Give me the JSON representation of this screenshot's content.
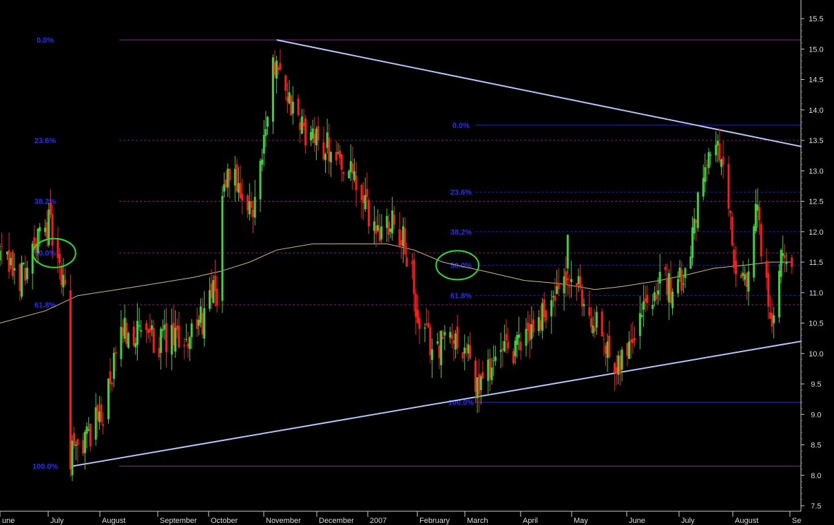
{
  "chart_data": {
    "type": "candlestick",
    "y_axis": {
      "position": "right",
      "ylim": [
        7.5,
        15.5
      ],
      "ticks": [
        "15.5",
        "15.0",
        "14.5",
        "14.0",
        "13.5",
        "13.0",
        "12.5",
        "12.0",
        "11.5",
        "11.0",
        "10.5",
        "10.0",
        "9.5",
        "9.0",
        "8.5",
        "8.0",
        "7.5"
      ]
    },
    "x_axis": {
      "months": [
        "une",
        "July",
        "August",
        "September",
        "October",
        "November",
        "December",
        "2007",
        "February",
        "March",
        "April",
        "May",
        "June",
        "July",
        "August",
        "Se"
      ],
      "date_range": [
        "2006-06-15",
        "2007-09-01"
      ]
    },
    "colors": {
      "up": "#3cd23c",
      "down": "#ff1a1a",
      "ma": "#d9c25a",
      "trend": "#b4c8ff",
      "fib1": "#8b1a8b",
      "fib2": "#1a1aff",
      "circle": "#22e622"
    },
    "anchors": [
      [
        "2006-06-15",
        11.6
      ],
      [
        "2006-06-25",
        11.2
      ],
      [
        "2006-07-05",
        11.8
      ],
      [
        "2006-07-12",
        12.2
      ],
      [
        "2006-07-18",
        11.3
      ],
      [
        "2006-07-22",
        11.0
      ],
      [
        "2006-07-24",
        8.3
      ],
      [
        "2006-08-01",
        8.6
      ],
      [
        "2006-08-12",
        9.1
      ],
      [
        "2006-08-22",
        10.4
      ],
      [
        "2006-09-01",
        10.3
      ],
      [
        "2006-09-12",
        10.2
      ],
      [
        "2006-09-22",
        10.2
      ],
      [
        "2006-10-02",
        10.4
      ],
      [
        "2006-10-12",
        11.0
      ],
      [
        "2006-10-15",
        10.9
      ],
      [
        "2006-10-16",
        12.6
      ],
      [
        "2006-10-22",
        13.2
      ],
      [
        "2006-10-26",
        12.3
      ],
      [
        "2006-11-02",
        12.4
      ],
      [
        "2006-11-10",
        14.0
      ],
      [
        "2006-11-15",
        15.0
      ],
      [
        "2006-11-20",
        14.3
      ],
      [
        "2006-11-26",
        13.8
      ],
      [
        "2006-12-05",
        13.5
      ],
      [
        "2006-12-15",
        13.4
      ],
      [
        "2006-12-25",
        13.0
      ],
      [
        "2007-01-01",
        12.5
      ],
      [
        "2007-01-10",
        12.0
      ],
      [
        "2007-01-18",
        12.3
      ],
      [
        "2007-01-28",
        11.5
      ],
      [
        "2007-02-01",
        10.4
      ],
      [
        "2007-02-10",
        10.1
      ],
      [
        "2007-02-20",
        10.3
      ],
      [
        "2007-02-28",
        10.1
      ],
      [
        "2007-03-05",
        9.4
      ],
      [
        "2007-03-15",
        9.9
      ],
      [
        "2007-03-25",
        10.0
      ],
      [
        "2007-04-05",
        10.4
      ],
      [
        "2007-04-15",
        10.8
      ],
      [
        "2007-04-28",
        11.2
      ],
      [
        "2007-05-08",
        10.6
      ],
      [
        "2007-05-18",
        10.0
      ],
      [
        "2007-05-25",
        9.9
      ],
      [
        "2007-06-03",
        10.6
      ],
      [
        "2007-06-12",
        11.1
      ],
      [
        "2007-06-22",
        11.1
      ],
      [
        "2007-06-28",
        11.2
      ],
      [
        "2007-07-03",
        12.0
      ],
      [
        "2007-07-10",
        13.3
      ],
      [
        "2007-07-15",
        13.4
      ],
      [
        "2007-07-22",
        12.9
      ],
      [
        "2007-07-26",
        11.3
      ],
      [
        "2007-08-02",
        11.1
      ],
      [
        "2007-08-08",
        12.4
      ],
      [
        "2007-08-12",
        11.2
      ],
      [
        "2007-08-16",
        10.5
      ],
      [
        "2007-08-20",
        11.5
      ],
      [
        "2007-08-27",
        11.6
      ]
    ],
    "moving_average": [
      [
        "2006-06-15",
        10.5
      ],
      [
        "2006-07-10",
        10.7
      ],
      [
        "2006-07-28",
        10.95
      ],
      [
        "2006-08-30",
        11.1
      ],
      [
        "2006-09-30",
        11.25
      ],
      [
        "2006-10-15",
        11.35
      ],
      [
        "2006-10-31",
        11.5
      ],
      [
        "2006-11-15",
        11.7
      ],
      [
        "2006-12-05",
        11.8
      ],
      [
        "2007-01-15",
        11.8
      ],
      [
        "2007-01-30",
        11.7
      ],
      [
        "2007-02-15",
        11.5
      ],
      [
        "2007-03-10",
        11.35
      ],
      [
        "2007-04-01",
        11.2
      ],
      [
        "2007-04-20",
        11.15
      ],
      [
        "2007-05-10",
        11.05
      ],
      [
        "2007-05-25",
        11.1
      ],
      [
        "2007-06-15",
        11.2
      ],
      [
        "2007-07-01",
        11.3
      ],
      [
        "2007-07-15",
        11.4
      ],
      [
        "2007-08-01",
        11.45
      ],
      [
        "2007-08-15",
        11.5
      ],
      [
        "2007-08-27",
        11.5
      ]
    ],
    "trend_lines": [
      {
        "from": [
          "2006-11-15",
          15.15
        ],
        "to": [
          "2007-09-01",
          13.4
        ]
      },
      {
        "from": [
          "2006-07-25",
          8.15
        ],
        "to": [
          "2007-09-01",
          10.2
        ]
      }
    ],
    "fib_retracements": [
      {
        "x_start": "2006-08-20",
        "x_end": "2007-09-01",
        "label_x": "2006-07-10",
        "style": "solid-dashed",
        "color": "#8b1a8b",
        "levels": [
          {
            "label": "0.0%",
            "value": 15.15,
            "solid": true
          },
          {
            "label": "23.6%",
            "value": 13.5
          },
          {
            "label": "38.2%",
            "value": 12.5
          },
          {
            "label": "50.0%",
            "value": 11.65
          },
          {
            "label": "61.8%",
            "value": 10.8
          },
          {
            "label": "100.0%",
            "value": 8.15,
            "solid": true
          }
        ]
      },
      {
        "x_start": "2007-03-05",
        "x_end": "2007-09-01",
        "label_x": "2007-02-25",
        "color": "#1a1aff",
        "levels": [
          {
            "label": "0.0%",
            "value": 13.75,
            "solid": true
          },
          {
            "label": "23.6%",
            "value": 12.65
          },
          {
            "label": "38.2%",
            "value": 12.0
          },
          {
            "label": "50.0%",
            "value": 11.45
          },
          {
            "label": "61.8%",
            "value": 10.95
          },
          {
            "label": "100.0%",
            "value": 9.2,
            "solid": true
          }
        ]
      }
    ],
    "highlight_circles": [
      {
        "x": "2006-07-15",
        "y": 11.65
      },
      {
        "x": "2007-02-23",
        "y": 11.45
      }
    ],
    "spikes": [
      {
        "x": "2007-04-25",
        "open": 11.4,
        "close": 11.95,
        "high": 11.95,
        "low": 11.3
      }
    ]
  }
}
